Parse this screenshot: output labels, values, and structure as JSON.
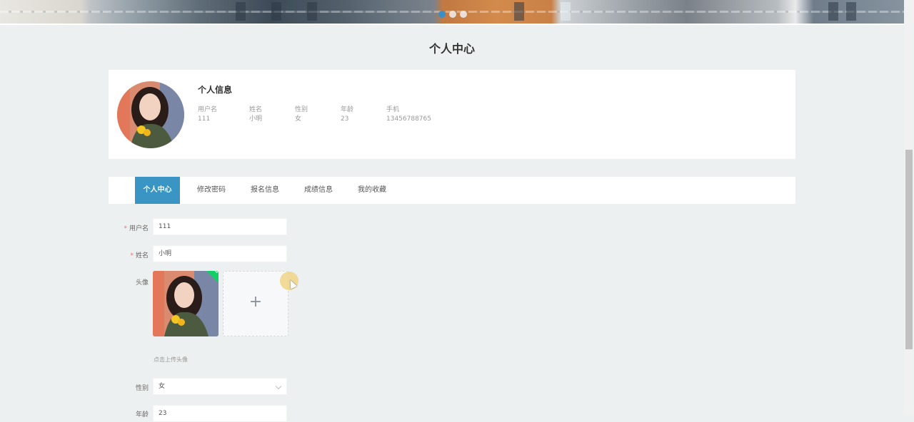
{
  "banner": {
    "slide_count": 3,
    "active_slide": 1
  },
  "page": {
    "title": "个人中心"
  },
  "profile": {
    "title": "个人信息",
    "fields": [
      {
        "label": "用户名",
        "value": "111"
      },
      {
        "label": "姓名",
        "value": "小明"
      },
      {
        "label": "性别",
        "value": "女"
      },
      {
        "label": "年龄",
        "value": "23"
      },
      {
        "label": "手机",
        "value": "13456788765"
      }
    ]
  },
  "tabs": [
    "个人中心",
    "修改密码",
    "报名信息",
    "成绩信息",
    "我的收藏"
  ],
  "active_tab": 0,
  "form": {
    "username_label": "用户名",
    "username_value": "111",
    "name_label": "姓名",
    "name_value": "小明",
    "avatar_label": "头像",
    "upload_plus": "+",
    "upload_hint": "点击上传头像",
    "gender_label": "性别",
    "gender_value": "女",
    "age_label": "年龄",
    "age_value": "23"
  },
  "colors": {
    "accent": "#3a94c4",
    "required": "#f56c6c",
    "success": "#13ce66"
  }
}
